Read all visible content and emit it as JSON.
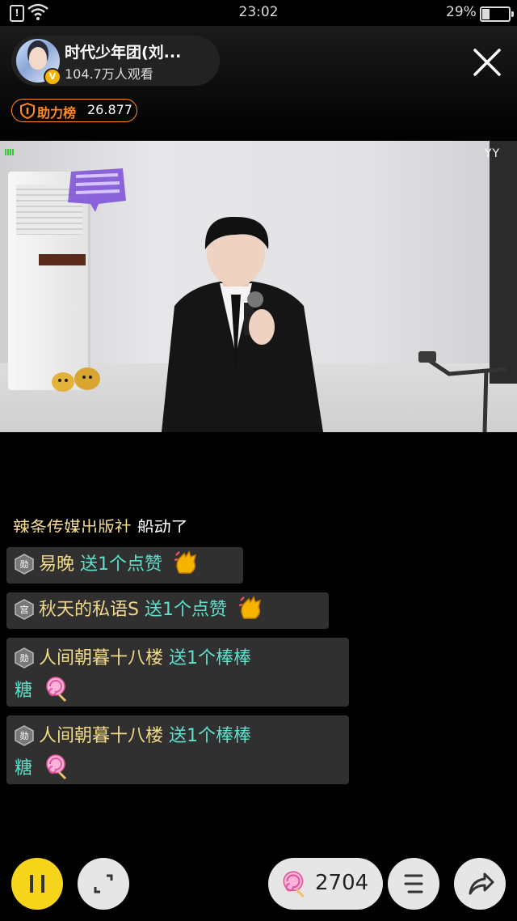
{
  "status_bar": {
    "time": "23:02",
    "battery": "29%",
    "alert_icon": "!"
  },
  "host": {
    "name": "时代少年团(刘...",
    "viewers": "104.7万人观看",
    "verified_badge": "V"
  },
  "rank": {
    "label": "助力榜",
    "value": "26.877"
  },
  "video": {
    "watermark": "YY"
  },
  "chat": {
    "partial_message": {
      "prefix": "辣条传媒出版社",
      "text": "船动了"
    },
    "messages": [
      {
        "badge": "勋",
        "name": "易晚",
        "action": "送1个点赞",
        "gift_icon": "clap-hand-icon"
      },
      {
        "badge": "宫",
        "name": "秋天的私语S",
        "action": "送1个点赞",
        "gift_icon": "clap-hand-icon"
      },
      {
        "badge": "勋",
        "name": "人间朝暮十八楼",
        "action": "送1个棒棒",
        "action_cont": "糖",
        "gift_icon": "lollipop-icon"
      },
      {
        "badge": "勋",
        "name": "人间朝暮十八楼",
        "action": "送1个棒棒",
        "action_cont": "糖",
        "gift_icon": "lollipop-icon"
      }
    ]
  },
  "bottom_bar": {
    "gift_count": "2704"
  },
  "colors": {
    "accent_yellow": "#f7d51a",
    "rank_orange": "#ff8a1e",
    "chat_name": "#f1d98a",
    "chat_action": "#5fe0cc"
  }
}
